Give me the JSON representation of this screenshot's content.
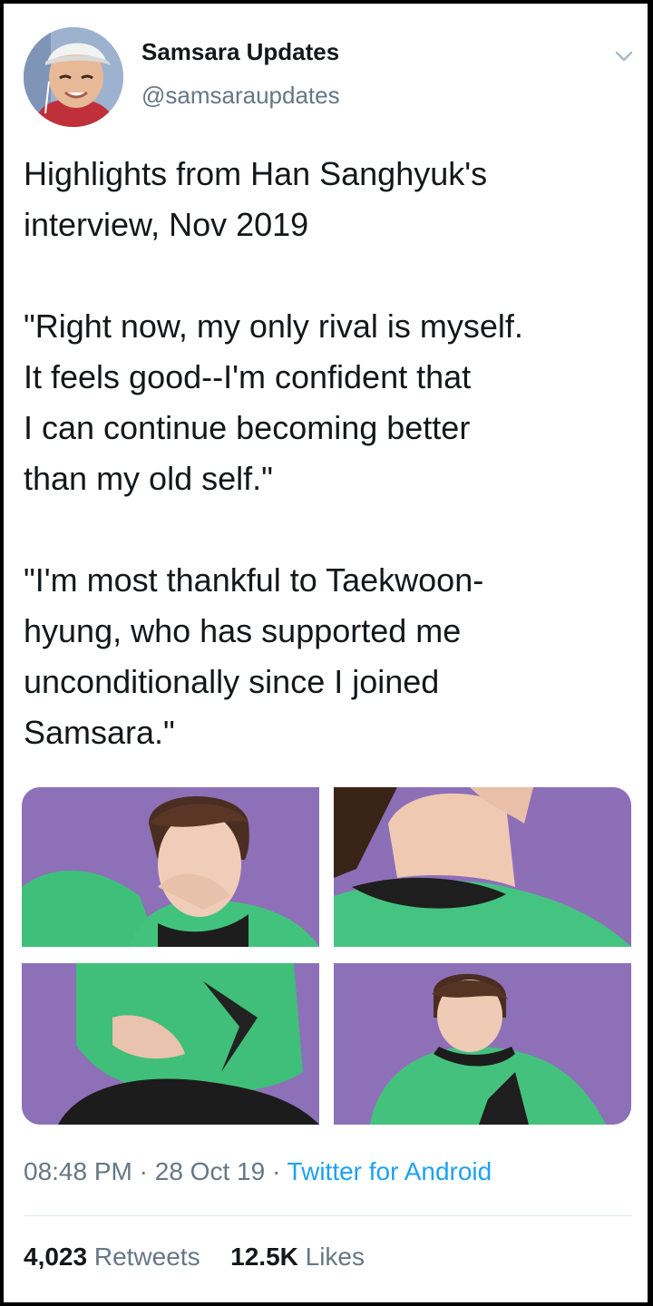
{
  "tweet": {
    "author_name": "Samsara Updates",
    "author_handle": "@samsaraupdates",
    "text": {
      "intro": "Highlights from Han Sanghyuk's\ninterview, Nov 2019",
      "quote1": "\"Right now, my only rival is myself.\nIt feels good--I'm confident that\nI can continue becoming better\nthan my old self.\"",
      "quote2": "\"I'm most thankful to Taekwoon-\nhyung, who has supported me\nunconditionally since I joined\nSamsara.\""
    },
    "time": "08:48 PM",
    "separator": "·",
    "date": "28 Oct 19",
    "source": "Twitter for Android",
    "retweets_count": "4,023",
    "retweets_label": "Retweets",
    "likes_count": "12.5K",
    "likes_label": "Likes"
  },
  "colors": {
    "text": "#14171a",
    "secondary": "#657786",
    "link": "#1da1f2",
    "photo_background": "#8e6fb7",
    "sweater": "#3fc07a"
  },
  "icons": {
    "menu": "chevron-down-icon"
  }
}
